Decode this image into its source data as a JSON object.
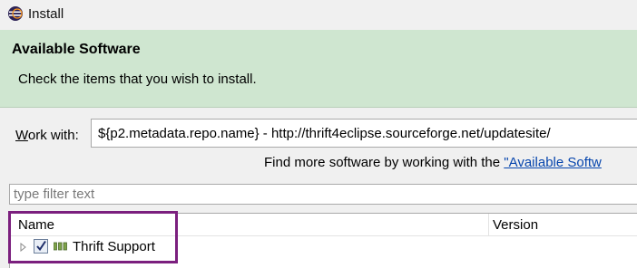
{
  "window": {
    "title": "Install"
  },
  "header": {
    "title": "Available Software",
    "description": "Check the items that you wish to install."
  },
  "work_with": {
    "label_mnemonic": "W",
    "label_rest": "ork with:",
    "value": "${p2.metadata.repo.name} - http://thrift4eclipse.sourceforge.net/updatesite/"
  },
  "find_more": {
    "prefix": "Find more software by working with the ",
    "link": "\"Available Softw"
  },
  "filter": {
    "placeholder": "type filter text"
  },
  "table": {
    "columns": [
      "Name",
      "Version"
    ],
    "rows": [
      {
        "name": "Thrift Support",
        "version": "",
        "checked": true
      }
    ]
  },
  "colors": {
    "header_bg": "#cfe6d0",
    "link": "#0645ad",
    "highlight": "#7b1f7e",
    "chrome_bg": "#f0f0f0"
  },
  "icons": [
    "eclipse-icon",
    "expand-arrow-icon",
    "checkbox-checked-icon",
    "feature-icon"
  ]
}
